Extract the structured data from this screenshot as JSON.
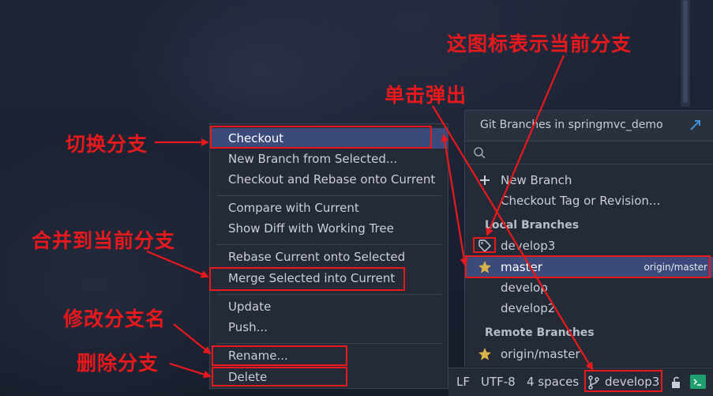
{
  "context_menu": {
    "items": [
      {
        "label": "Checkout",
        "selected": true
      },
      {
        "label": "New Branch from Selected..."
      },
      {
        "label": "Checkout and Rebase onto Current"
      },
      {
        "label": "Compare with Current"
      },
      {
        "label": "Show Diff with Working Tree"
      },
      {
        "label": "Rebase Current onto Selected"
      },
      {
        "label": "Merge Selected into Current"
      },
      {
        "label": "Update"
      },
      {
        "label": "Push..."
      },
      {
        "label": "Rename..."
      },
      {
        "label": "Delete"
      }
    ]
  },
  "branches_popup": {
    "title": "Git Branches in springmvc_demo",
    "search_placeholder": "",
    "actions": [
      {
        "label": "New Branch",
        "icon": "plus-icon"
      },
      {
        "label": "Checkout Tag or Revision..."
      }
    ],
    "local_header": "Local Branches",
    "local": [
      {
        "name": "develop3",
        "icon": "tag-icon",
        "current": true
      },
      {
        "name": "master",
        "icon": "star-icon",
        "tracking": "origin/master",
        "selected": true
      },
      {
        "name": "develop"
      },
      {
        "name": "develop2"
      }
    ],
    "remote_header": "Remote Branches",
    "remote": [
      {
        "name": "origin/master",
        "icon": "star-icon"
      }
    ]
  },
  "status_bar": {
    "line_sep": "LF",
    "encoding": "UTF-8",
    "indent": "4 spaces",
    "branch": "develop3"
  },
  "annotations": {
    "current_branch_icon": "这图标表示当前分支",
    "click_popup": "单击弹出",
    "switch_branch": "切换分支",
    "merge": "合并到当前分支",
    "rename": "修改分支名",
    "delete": "删除分支"
  },
  "colors": {
    "annotation_red": "#e8191c",
    "selection": "#3b4a7a",
    "star": "#d9b34a",
    "terminal": "#1f9e6e"
  }
}
